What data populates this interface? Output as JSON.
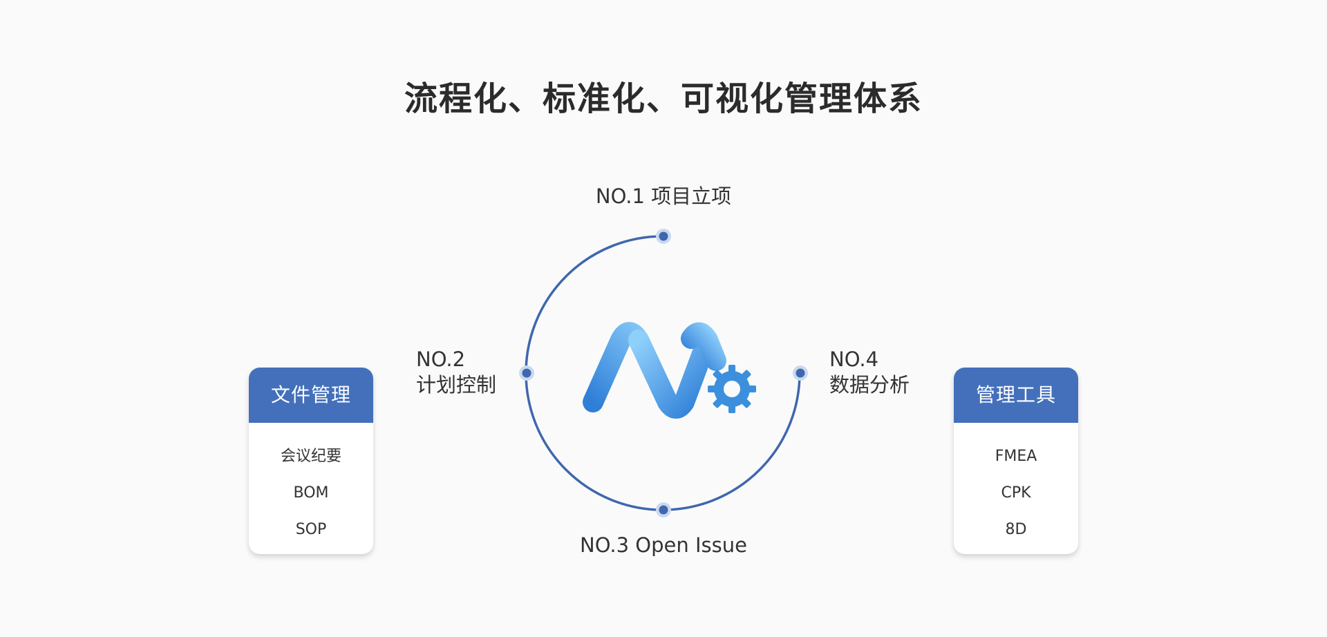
{
  "title": "流程化、标准化、可视化管理体系",
  "steps": {
    "step1": "NO.1 项目立项",
    "step2": {
      "no": "NO.2",
      "label": "计划控制"
    },
    "step3": "NO.3 Open Issue",
    "step4": {
      "no": "NO.4",
      "label": "数据分析"
    }
  },
  "left_card": {
    "title": "文件管理",
    "items": [
      "会议纪要",
      "BOM",
      "SOP"
    ]
  },
  "right_card": {
    "title": "管理工具",
    "items": [
      "FMEA",
      "CPK",
      "8D"
    ]
  },
  "colors": {
    "accent": "#4470bb",
    "circle_stroke": "#3f67ad",
    "logo_light": "#7ec3f7",
    "logo_dark": "#2f7fd8",
    "gear": "#3c8fdc",
    "background": "#fafafa"
  },
  "icons": {
    "center_logo": "m-gear-logo-icon"
  }
}
